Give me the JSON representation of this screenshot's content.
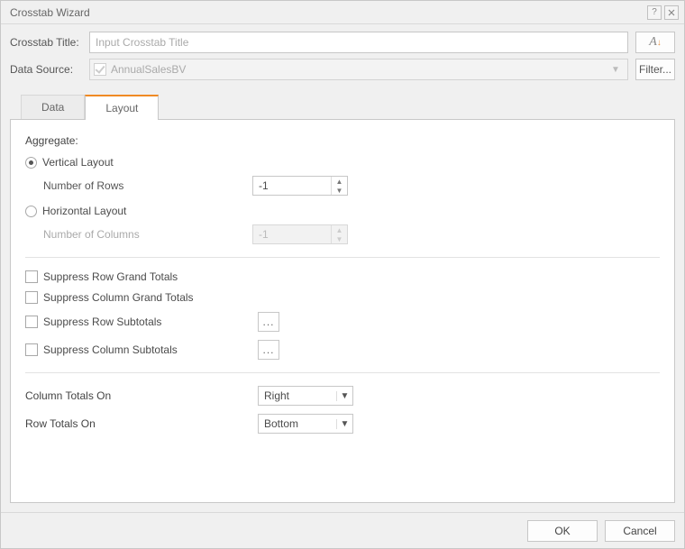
{
  "titlebar": {
    "title": "Crosstab Wizard"
  },
  "header": {
    "title_label": "Crosstab Title:",
    "title_placeholder": "Input Crosstab Title",
    "title_value": "",
    "datasource_label": "Data Source:",
    "datasource_value": "AnnualSalesBV",
    "filter_label": "Filter..."
  },
  "tabs": {
    "data": "Data",
    "layout": "Layout"
  },
  "layout": {
    "aggregate_label": "Aggregate:",
    "vertical_label": "Vertical Layout",
    "num_rows_label": "Number of Rows",
    "num_rows_value": "-1",
    "horizontal_label": "Horizontal Layout",
    "num_cols_label": "Number of Columns",
    "num_cols_value": "-1",
    "suppress_row_grand": "Suppress Row Grand Totals",
    "suppress_col_grand": "Suppress Column Grand Totals",
    "suppress_row_sub": "Suppress Row Subtotals",
    "suppress_col_sub": "Suppress Column Subtotals",
    "more_label": "...",
    "col_totals_label": "Column Totals On",
    "col_totals_value": "Right",
    "row_totals_label": "Row Totals On",
    "row_totals_value": "Bottom"
  },
  "footer": {
    "ok": "OK",
    "cancel": "Cancel"
  }
}
